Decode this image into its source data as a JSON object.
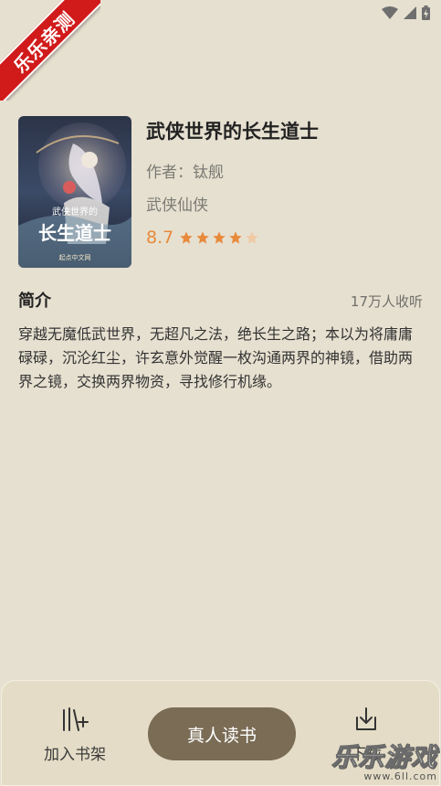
{
  "status_bar": {
    "icons": [
      "wifi-icon",
      "signal-icon",
      "battery-charging-icon"
    ]
  },
  "ribbon": {
    "text": "乐乐亲测"
  },
  "book": {
    "title": "武侠世界的长生道士",
    "author": "作者：钛舰",
    "genre": "武侠仙侠",
    "rating": "8.7",
    "stars": 4,
    "cover": {
      "title": "武侠世界的",
      "title_big": "长生道士",
      "publisher": "起点中文网"
    }
  },
  "intro": {
    "title": "简介",
    "listen_count": "17万人收听",
    "text": "穿越无魔低武世界，无超凡之法，绝长生之路；本以为将庸庸碌碌，沉沦红尘，许玄意外觉醒一枚沟通两界的神镜，借助两界之镜，交换两界物资，寻找修行机缘。"
  },
  "bottom_bar": {
    "shelf_label": "加入书架",
    "read_label": "真人读书",
    "download_label": "下载"
  },
  "watermark": {
    "main": "乐乐游戏",
    "sub": "www.6ll.com"
  },
  "colors": {
    "background": "#e6e0d0",
    "accent_button": "#7a6c55",
    "rating": "#e88a3c",
    "ribbon": "#d11a1a"
  }
}
